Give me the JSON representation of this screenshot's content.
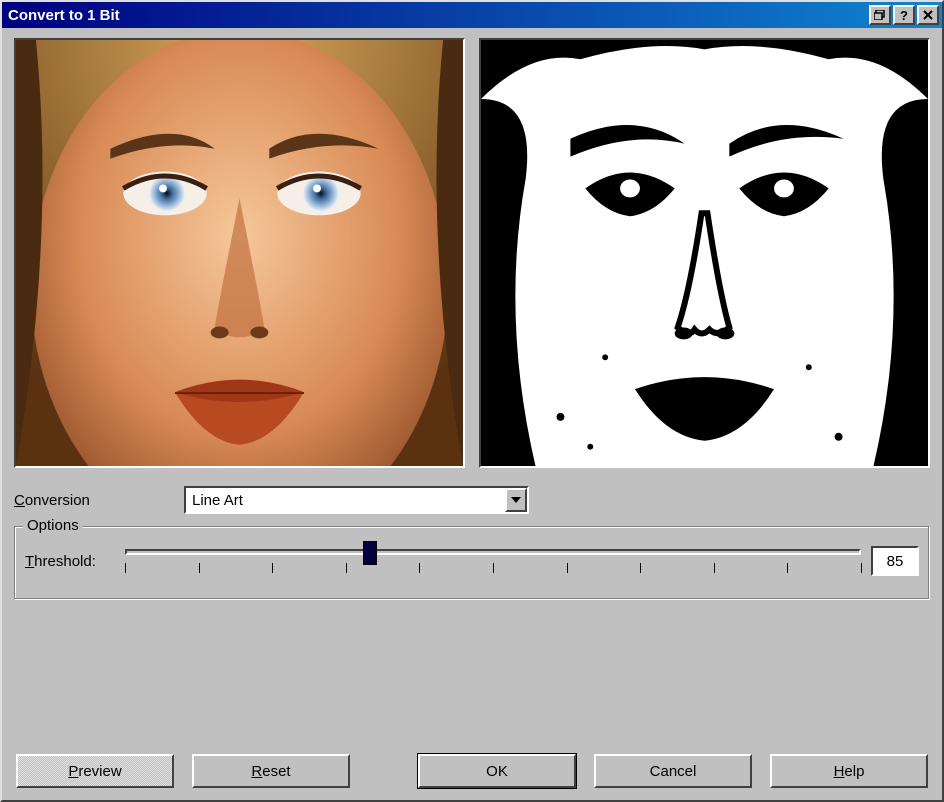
{
  "window": {
    "title": "Convert to 1 Bit"
  },
  "conversion": {
    "label": "Conversion",
    "label_access_char": "C",
    "selected": "Line Art"
  },
  "options": {
    "group_label": "Options",
    "threshold_label": "Threshold:",
    "threshold_access_char": "T",
    "threshold_value": "85",
    "threshold_min": 0,
    "threshold_max": 255,
    "threshold_percent": 33.3
  },
  "buttons": {
    "preview": "Preview",
    "preview_access_char": "P",
    "reset": "Reset",
    "reset_access_char": "R",
    "ok": "OK",
    "cancel": "Cancel",
    "help": "Help",
    "help_access_char": "H"
  },
  "previews": {
    "original_label": "original-image-preview",
    "result_label": "result-1bit-preview"
  }
}
